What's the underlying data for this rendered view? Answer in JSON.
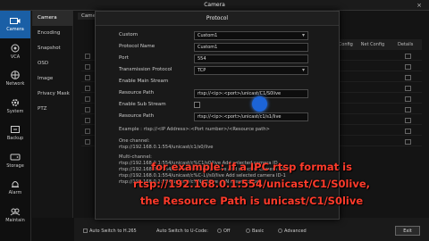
{
  "window": {
    "title": "Camera",
    "close": "×"
  },
  "rail": [
    {
      "label": "Camera",
      "icon": "camera-icon",
      "active": true
    },
    {
      "label": "VCA",
      "icon": "vca-icon"
    },
    {
      "label": "Network",
      "icon": "network-icon"
    },
    {
      "label": "System",
      "icon": "system-gear-icon"
    },
    {
      "label": "Backup",
      "icon": "backup-icon"
    },
    {
      "label": "Storage",
      "icon": "storage-icon"
    },
    {
      "label": "Alarm",
      "icon": "alarm-icon"
    },
    {
      "label": "Maintain",
      "icon": "maintain-icon"
    }
  ],
  "submenu": [
    "Camera",
    "Encoding",
    "Snapshot",
    "OSD",
    "Image",
    "Privacy Mask",
    "PTZ"
  ],
  "main": {
    "tab": "Camera",
    "columns": [
      "Cam Config",
      "Net Config",
      "Details"
    ]
  },
  "bottombar": {
    "auto_h265": "Auto Switch to H.265",
    "auto_ucode": "Auto Switch to U-Code:",
    "off": "Off",
    "basic": "Basic",
    "advanced": "Advanced",
    "exit": "Exit"
  },
  "dialog": {
    "title": "Protocol",
    "custom_label": "Custom",
    "custom_value": "Custom1",
    "protocol_name_label": "Protocol Name",
    "protocol_name_value": "Custom1",
    "port_label": "Port",
    "port_value": "554",
    "transmission_label": "Transmission Protocol",
    "transmission_value": "TCP",
    "enable_main_label": "Enable Main Stream",
    "resource_path_label": "Resource Path",
    "resource_path_value": "rtsp://<ip>:<port>/unicast/C1/S0live",
    "enable_sub_label": "Enable Sub Stream",
    "resource_path2_label": "Resource Path",
    "resource_path2_value": "rtsp://<ip>:<port>/unicast/c1/s1/live",
    "example": "Example : rtsp://<IP Address>:<Port number>/<Resource path>",
    "one_channel_title": "One channel:",
    "one_channel_value": "rtsp://192.168.0.1:554/unicast/c1/s0/live",
    "multi_title": "Multi-channel:",
    "multi_lines": [
      "rtsp://192.168.0.1:554/unicast/c%C1/s0/live Add selected camera ID",
      "rtsp://192.168.0.1:554/unicast/c%C+1)/s0/live Add selected camera ID+1",
      "rtsp://192.168.0.1:554/unicast/c%C-1)/s0/live Add selected camera ID-1",
      "rtsp://192.168.0.1:554/unicast/c%N/s0/live ... N means offset"
    ]
  },
  "caption": [
    "for example: if a IPC rtsp format is",
    "rtsp://192.168.0.1:554/unicast/C1/S0live,",
    "the Resource Path is unicast/C1/S0live"
  ]
}
